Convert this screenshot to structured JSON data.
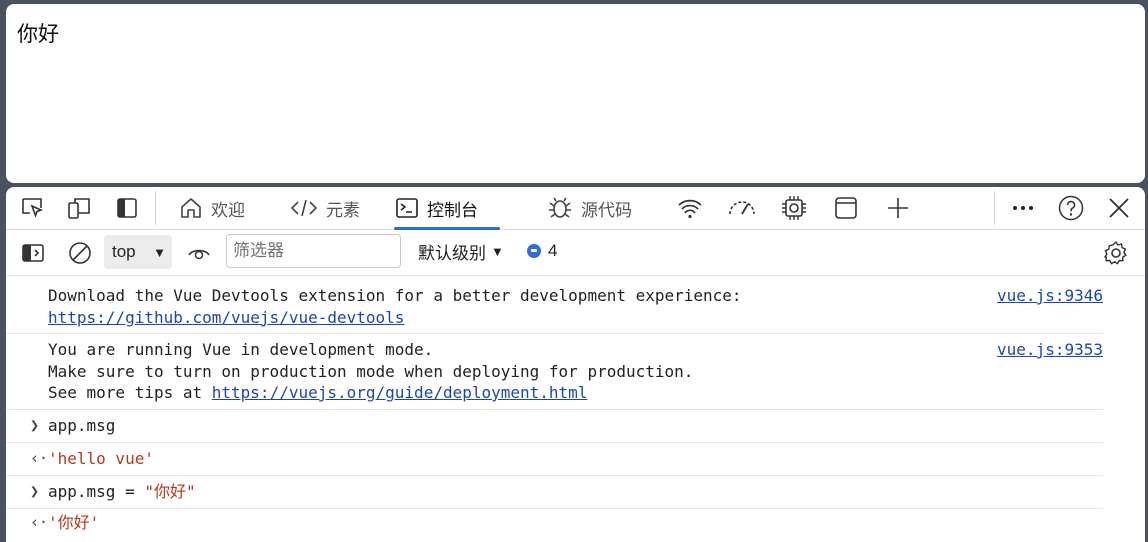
{
  "page": {
    "content_text": "你好"
  },
  "devtools": {
    "tabs": [
      {
        "label": "欢迎",
        "icon": "home-icon"
      },
      {
        "label": "元素",
        "icon": "code-icon"
      },
      {
        "label": "控制台",
        "icon": "console-icon",
        "active": true
      },
      {
        "label": "源代码",
        "icon": "bug-icon"
      }
    ],
    "toolbar": {
      "context": "top",
      "filter_placeholder": "筛选器",
      "level": "默认级别",
      "message_count": "4"
    },
    "accent_color": "#2a6fd6",
    "console": {
      "entries": [
        {
          "lines": [
            "Download the Vue Devtools extension for a better development experience:"
          ],
          "link": "https://github.com/vuejs/vue-devtools",
          "source": "vue.js:9346"
        },
        {
          "lines": [
            "You are running Vue in development mode.",
            "Make sure to turn on production mode when deploying for production.",
            "See more tips at "
          ],
          "link": "https://vuejs.org/guide/deployment.html",
          "source": "vue.js:9353"
        },
        {
          "input": "app.msg"
        },
        {
          "output": "'hello vue'"
        },
        {
          "input_prefix": "app.msg = ",
          "input_string": "\"你好\""
        },
        {
          "output": "'你好'"
        }
      ]
    }
  }
}
